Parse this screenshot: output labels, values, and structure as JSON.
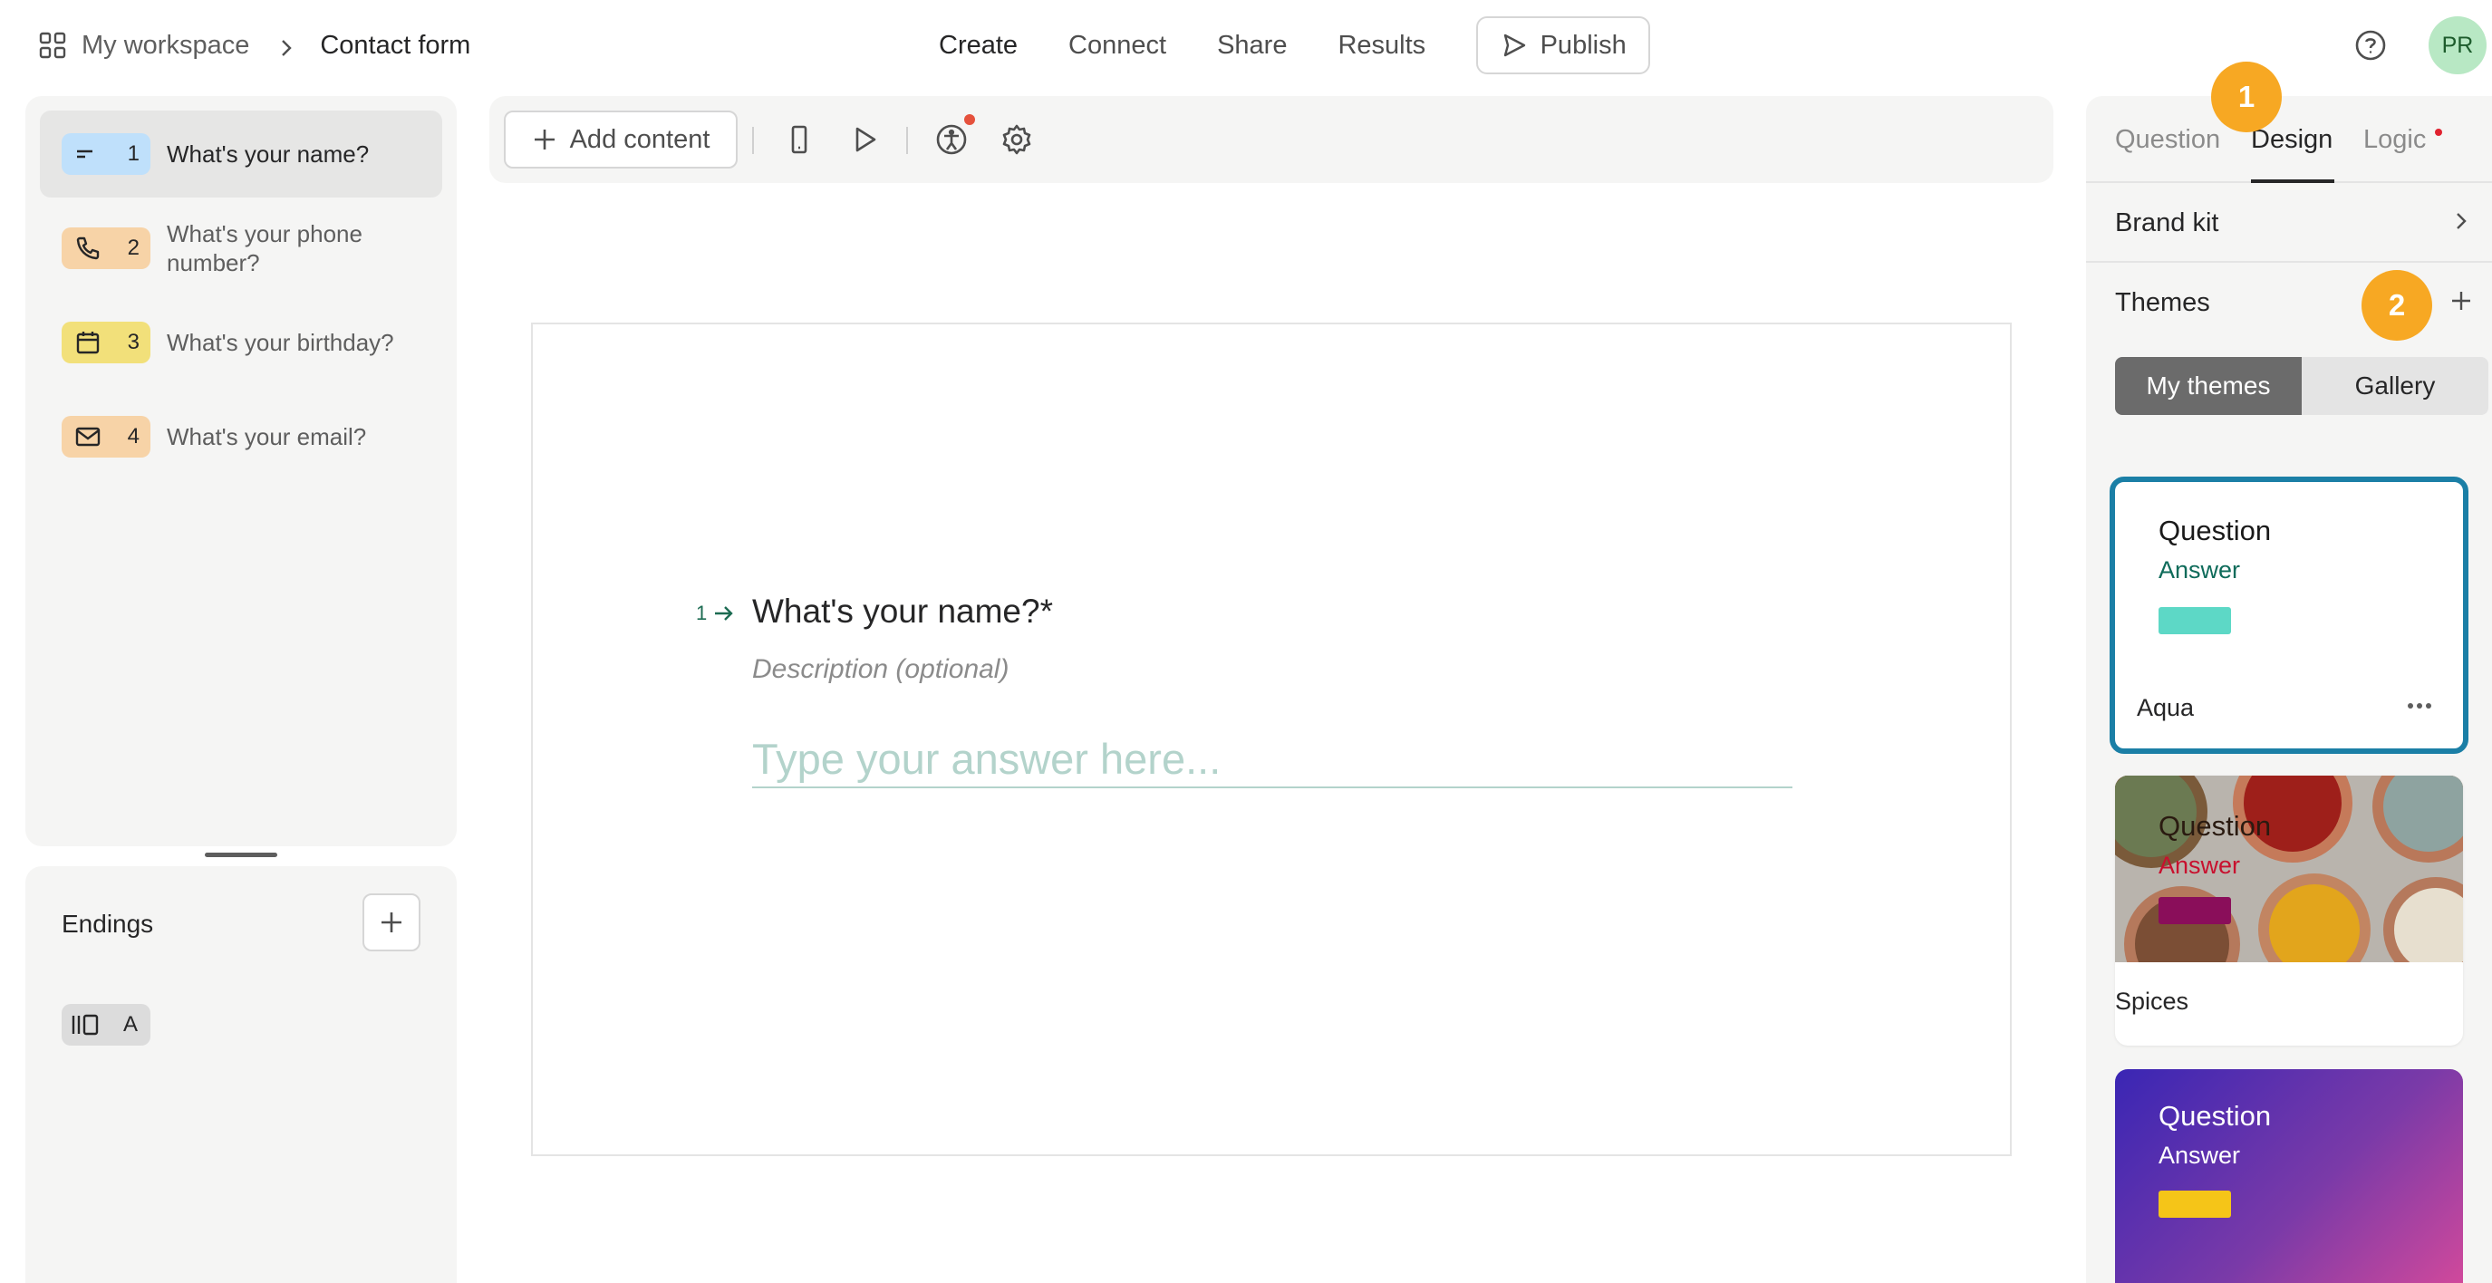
{
  "topbar": {
    "workspace": "My workspace",
    "form_name": "Contact form",
    "nav": [
      "Create",
      "Connect",
      "Share",
      "Results"
    ],
    "active_nav": "Create",
    "publish_label": "Publish",
    "avatar_initials": "PR"
  },
  "questions": [
    {
      "number": "1",
      "label": "What's your name?",
      "type_icon": "short-text-icon",
      "badge_color": "#bfe0fb"
    },
    {
      "number": "2",
      "label": "What's your phone number?",
      "type_icon": "phone-icon",
      "badge_color": "#f7d3a7"
    },
    {
      "number": "3",
      "label": "What's your birthday?",
      "type_icon": "calendar-icon",
      "badge_color": "#f2e07a"
    },
    {
      "number": "4",
      "label": "What's your email?",
      "type_icon": "envelope-icon",
      "badge_color": "#f7d3a7"
    }
  ],
  "endings": {
    "title": "Endings",
    "items": [
      {
        "label": "A",
        "icon": "ending-icon"
      }
    ]
  },
  "toolbar": {
    "add_content_label": "Add content",
    "icons": [
      "mobile-preview-icon",
      "play-icon",
      "accessibility-icon",
      "settings-icon"
    ]
  },
  "canvas": {
    "question_number": "1",
    "question_title": "What's your name?*",
    "description_placeholder": "Description (optional)",
    "answer_placeholder": "Type your answer here..."
  },
  "right_panel": {
    "tabs": [
      "Question",
      "Design",
      "Logic"
    ],
    "active_tab": "Design",
    "brand_kit_label": "Brand kit",
    "themes_label": "Themes",
    "segments": [
      "My themes",
      "Gallery"
    ],
    "selected_segment": "My themes",
    "themes": [
      {
        "name": "Aqua",
        "question": "Question",
        "answer": "Answer",
        "question_color": "#1a1a1a",
        "answer_color": "#0e6b5a",
        "button_color": "#5dd8c6"
      },
      {
        "name": "Spices",
        "question": "Question",
        "answer": "Answer",
        "question_color": "#2a1a10",
        "answer_color": "#c8102e",
        "button_color": "#8a0e5a"
      },
      {
        "name": "",
        "question": "Question",
        "answer": "Answer",
        "question_color": "#ffffff",
        "answer_color": "#ffffff",
        "button_color": "#f5c518"
      }
    ]
  },
  "markers": [
    "1",
    "2"
  ],
  "colors": {
    "accent": "#f7a823",
    "selected_border": "#1b7fa6",
    "answer_teal": "#b3d3cb"
  }
}
